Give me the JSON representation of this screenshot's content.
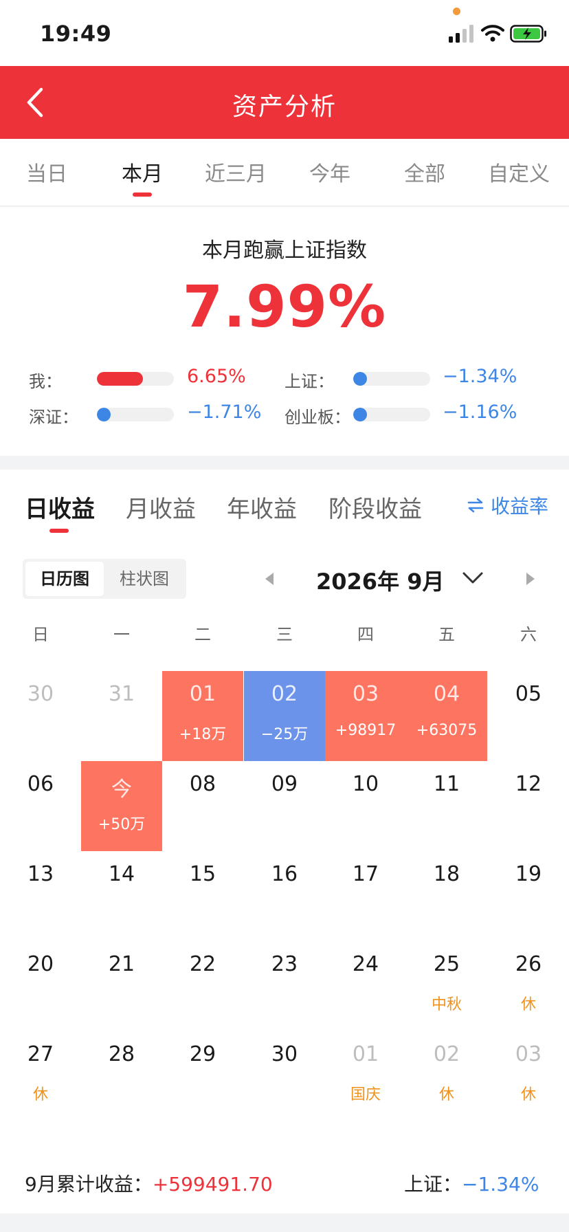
{
  "status_bar": {
    "time": "19:49"
  },
  "nav": {
    "title": "资产分析"
  },
  "period_tabs": [
    "当日",
    "本月",
    "近三月",
    "今年",
    "全部",
    "自定义"
  ],
  "summary": {
    "title": "本月跑赢上证指数",
    "value": "7.99%",
    "benchmarks": [
      {
        "label": "我：",
        "value": "6.65%",
        "fill_fraction": 0.6
      },
      {
        "label": "上证：",
        "value": "−1.34%",
        "fill_fraction": 0.08
      },
      {
        "label": "深证：",
        "value": "−1.71%",
        "fill_fraction": 0.1
      },
      {
        "label": "创业板：",
        "value": "−1.16%",
        "fill_fraction": 0.07
      }
    ]
  },
  "earnings": {
    "tabs": [
      "日收益",
      "月收益",
      "年收益",
      "阶段收益"
    ],
    "rate_toggle_label": "收益率",
    "view_options": [
      "日历图",
      "柱状图"
    ],
    "month": "2026年 9月",
    "weekdays": [
      "日",
      "一",
      "二",
      "三",
      "四",
      "五",
      "六"
    ],
    "calendar": [
      [
        {
          "day": "30",
          "faded": true
        },
        {
          "day": "31",
          "faded": true
        },
        {
          "day": "01",
          "sub": "+18万",
          "status": "gain"
        },
        {
          "day": "02",
          "sub": "−25万",
          "status": "loss"
        },
        {
          "day": "03",
          "sub": "+98917",
          "status": "gain"
        },
        {
          "day": "04",
          "sub": "+63075",
          "status": "gain"
        },
        {
          "day": "05"
        }
      ],
      [
        {
          "day": "06"
        },
        {
          "day": "今",
          "sub": "+50万",
          "status": "gain"
        },
        {
          "day": "08"
        },
        {
          "day": "09"
        },
        {
          "day": "10"
        },
        {
          "day": "11"
        },
        {
          "day": "12"
        }
      ],
      [
        {
          "day": "13"
        },
        {
          "day": "14"
        },
        {
          "day": "15"
        },
        {
          "day": "16"
        },
        {
          "day": "17"
        },
        {
          "day": "18"
        },
        {
          "day": "19"
        }
      ],
      [
        {
          "day": "20"
        },
        {
          "day": "21"
        },
        {
          "day": "22"
        },
        {
          "day": "23"
        },
        {
          "day": "24"
        },
        {
          "day": "25",
          "sub": "中秋",
          "holiday": true
        },
        {
          "day": "26",
          "sub": "休",
          "holiday": true
        }
      ],
      [
        {
          "day": "27",
          "sub": "休",
          "holiday": true
        },
        {
          "day": "28"
        },
        {
          "day": "29"
        },
        {
          "day": "30"
        },
        {
          "day": "01",
          "faded": true,
          "sub": "国庆",
          "holiday": true
        },
        {
          "day": "02",
          "faded": true,
          "sub": "休",
          "holiday": true
        },
        {
          "day": "03",
          "faded": true,
          "sub": "休",
          "holiday": true
        }
      ]
    ],
    "footer": {
      "total_label": "9月累计收益：",
      "total_value": "+599491.70",
      "index_label": "上证：",
      "index_value": "−1.34%"
    }
  },
  "colors": {
    "brand_red": "#ee3239",
    "gain": "#fd7561",
    "loss": "#6c93ea",
    "negative_text": "#3d86e6",
    "holiday": "#f0921c"
  }
}
